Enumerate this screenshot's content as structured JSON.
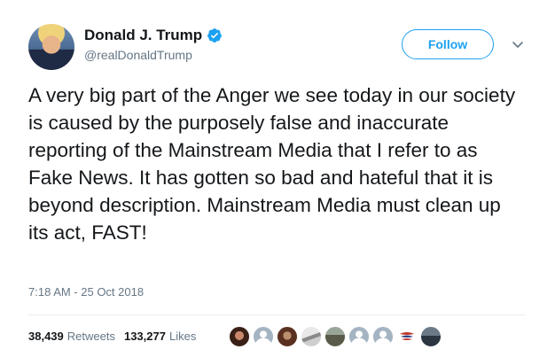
{
  "user": {
    "display_name": "Donald J. Trump",
    "handle": "@realDonaldTrump",
    "verified": true
  },
  "actions": {
    "follow_label": "Follow"
  },
  "tweet": {
    "text": "A very big part of the Anger we see today in our society is caused by the purposely false and inaccurate reporting of the Mainstream Media that I refer to as Fake News. It has gotten so bad and hateful that it is beyond description. Mainstream Media must clean up its act, FAST!",
    "timestamp": "7:18 AM - 25 Oct 2018"
  },
  "stats": {
    "retweets_count": "38,439",
    "retweets_label": "Retweets",
    "likes_count": "133,277",
    "likes_label": "Likes"
  },
  "colors": {
    "accent": "#1da1f2",
    "text_primary": "#14171a",
    "text_secondary": "#657786",
    "divider": "#e6ecf0"
  },
  "icons": {
    "verified": "verified-badge-icon",
    "caret": "chevron-down-icon"
  }
}
